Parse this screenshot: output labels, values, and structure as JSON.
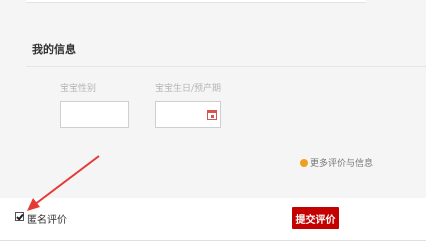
{
  "my_info": {
    "title": "我的信息",
    "gender_label": "宝宝性别",
    "birth_label": "宝宝生日/预产期",
    "more_link": "更多评价与信息"
  },
  "footer": {
    "anonymous_label": "匿名评价",
    "anonymous_checked": true,
    "submit_label": "提交评价"
  },
  "colors": {
    "submit_bg": "#c40000",
    "annotation_arrow": "#e53935",
    "more_dot": "#f0a020"
  },
  "icons": [
    "calendar-icon",
    "info-dot-icon",
    "checkbox-icon",
    "annotation-arrow"
  ]
}
